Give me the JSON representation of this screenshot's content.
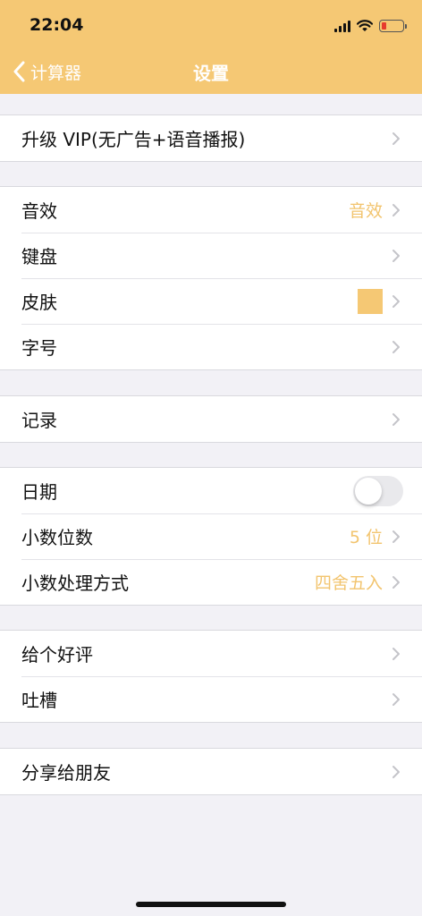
{
  "status_bar": {
    "time": "22:04",
    "battery_color": "#e63b2e"
  },
  "nav": {
    "back_label": "计算器",
    "title": "设置"
  },
  "theme": {
    "accent": "#f5c874"
  },
  "groups": [
    {
      "rows": [
        {
          "label": "升级 VIP(无广告+语音播报)"
        }
      ]
    },
    {
      "rows": [
        {
          "label": "音效",
          "value": "音效"
        },
        {
          "label": "键盘"
        },
        {
          "label": "皮肤"
        },
        {
          "label": "字号"
        }
      ]
    },
    {
      "rows": [
        {
          "label": "记录"
        }
      ]
    },
    {
      "rows": [
        {
          "label": "日期",
          "toggle_on": false
        },
        {
          "label": "小数位数",
          "value": "5 位"
        },
        {
          "label": "小数处理方式",
          "value": "四舍五入"
        }
      ]
    },
    {
      "rows": [
        {
          "label": "给个好评"
        },
        {
          "label": "吐槽"
        }
      ]
    },
    {
      "rows": [
        {
          "label": "分享给朋友"
        }
      ]
    }
  ]
}
